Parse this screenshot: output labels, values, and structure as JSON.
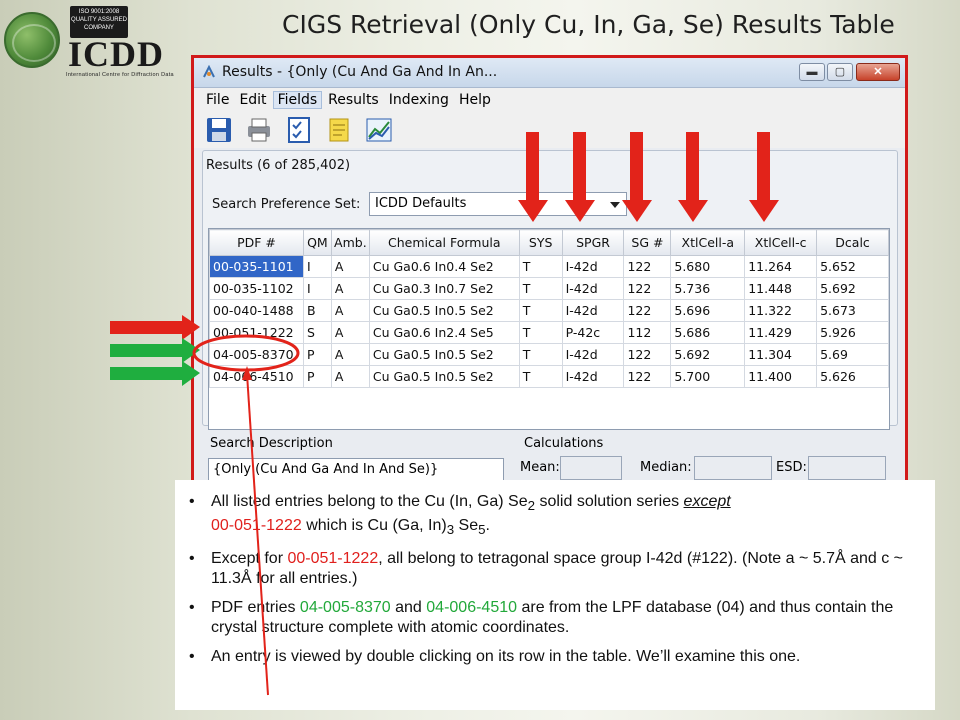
{
  "slide": {
    "title": "CIGS Retrieval (Only Cu, In, Ga, Se) Results Table",
    "logo_text": "ICDD",
    "logo_subtitle": "International Centre for Diffraction Data",
    "logo_iso_badge": "ISO 9001:2008 QUALITY ASSURED COMPANY"
  },
  "window": {
    "title": "Results - {Only (Cu And Ga And In An...",
    "buttons": {
      "minimize": "▬",
      "maximize": "▢",
      "close": "✕"
    }
  },
  "menu": [
    "File",
    "Edit",
    "Fields",
    "Results",
    "Indexing",
    "Help"
  ],
  "toolbar_icons": [
    "save-icon",
    "print-icon",
    "checklist-icon",
    "notes-icon",
    "graph-icon"
  ],
  "results": {
    "count_label": "Results (6 of 285,402)",
    "pref_label": "Search Preference Set:",
    "pref_value": "ICDD Defaults",
    "columns": [
      "PDF #",
      "QM",
      "Amb.",
      "Chemical Formula",
      "SYS",
      "SPGR",
      "SG #",
      "XtlCell-a",
      "XtlCell-c",
      "Dcalc"
    ],
    "rows": [
      [
        "00-035-1101",
        "I",
        "A",
        "Cu Ga0.6 In0.4 Se2",
        "T",
        "I-42d",
        "122",
        "5.680",
        "11.264",
        "5.652"
      ],
      [
        "00-035-1102",
        "I",
        "A",
        "Cu Ga0.3 In0.7 Se2",
        "T",
        "I-42d",
        "122",
        "5.736",
        "11.448",
        "5.692"
      ],
      [
        "00-040-1488",
        "B",
        "A",
        "Cu Ga0.5 In0.5 Se2",
        "T",
        "I-42d",
        "122",
        "5.696",
        "11.322",
        "5.673"
      ],
      [
        "00-051-1222",
        "S",
        "A",
        "Cu Ga0.6 In2.4 Se5",
        "T",
        "P-42c",
        "112",
        "5.686",
        "11.429",
        "5.926"
      ],
      [
        "04-005-8370",
        "P",
        "A",
        "Cu Ga0.5 In0.5 Se2",
        "T",
        "I-42d",
        "122",
        "5.692",
        "11.304",
        "5.69"
      ],
      [
        "04-006-4510",
        "P",
        "A",
        "Cu Ga0.5 In0.5 Se2",
        "T",
        "I-42d",
        "122",
        "5.700",
        "11.400",
        "5.626"
      ]
    ]
  },
  "search_description": {
    "label": "Search Description",
    "value": "{Only (Cu And Ga And In And Se)}"
  },
  "calculations": {
    "label": "Calculations",
    "mean": "Mean:",
    "median": "Median:",
    "esd": "ESD:"
  },
  "notes": {
    "b1_a": "All listed entries belong to the Cu (In, Ga) Se",
    "b1_sub": "2",
    "b1_b": " solid solution series ",
    "b1_except": "except",
    "b1_id": "00-051-1222",
    "b1_c": " which is Cu (Ga, In)",
    "b1_sub2": "3",
    "b1_d": " Se",
    "b1_sub3": "5",
    "b1_e": ".",
    "b2_a": "Except for ",
    "b2_id": "00-051-1222",
    "b2_b": ", all belong to tetragonal space group I-42d (#122). (Note a ~ 5.7Å and c ~ 11.3Å for all entries.)",
    "b3_a": "PDF entries ",
    "b3_id1": "04-005-8370",
    "b3_b": " and ",
    "b3_id2": "04-006-4510",
    "b3_c": " are from the LPF database (04) and thus contain the crystal structure complete with atomic coordinates.",
    "b4": "An entry is viewed by double clicking on its row in the table. We’ll examine this one."
  },
  "colors": {
    "accent_red": "#e0201d",
    "accent_green": "#22a83a",
    "selection_blue": "#3166c7"
  }
}
